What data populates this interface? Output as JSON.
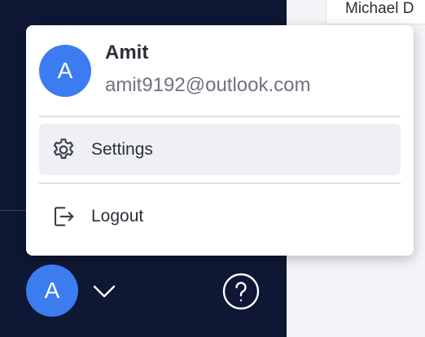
{
  "main": {
    "partial_user_name": "Michael D"
  },
  "user_menu": {
    "avatar_initial": "A",
    "name": "Amit",
    "email": "amit9192@outlook.com",
    "items": [
      {
        "label": "Settings",
        "icon": "gear-icon"
      },
      {
        "label": "Logout",
        "icon": "logout-icon"
      }
    ]
  },
  "footer": {
    "avatar_initial": "A",
    "chevron_icon": "chevron-down-icon",
    "help_icon": "help-circle-icon"
  },
  "colors": {
    "sidebar_bg": "#0e1733",
    "avatar_bg": "#3b7cf0",
    "active_item_bg": "#eff0f5"
  }
}
